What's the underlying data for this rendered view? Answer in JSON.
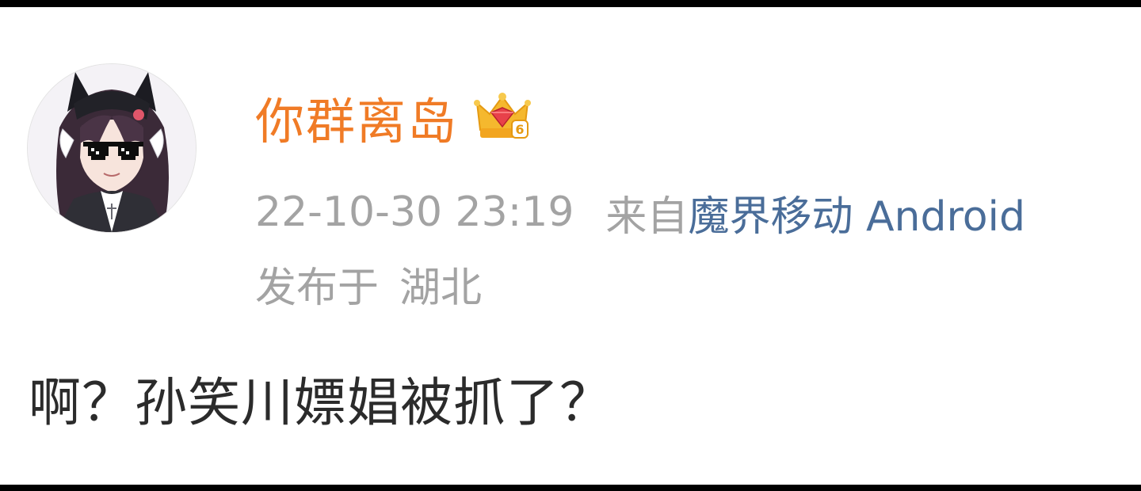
{
  "post": {
    "username": "你群离岛",
    "vip_level": "6",
    "timestamp": "22-10-30 23:19",
    "from_label": "来自",
    "source": "魔界移动 Android",
    "location_prefix": "发布于",
    "location": "湖北",
    "content": "啊？孙笑川嫖娼被抓了？"
  },
  "colors": {
    "username": "#f07b26",
    "meta_text": "#a3a3a3",
    "source_link": "#4a6d99",
    "content_text": "#2b2b2b",
    "crown": "#f5b82e",
    "gem": "#e8414a",
    "background": "#ffffff"
  },
  "icons": {
    "vip_badge": "crown-icon",
    "avatar": "avatar-anime-sunglasses"
  }
}
